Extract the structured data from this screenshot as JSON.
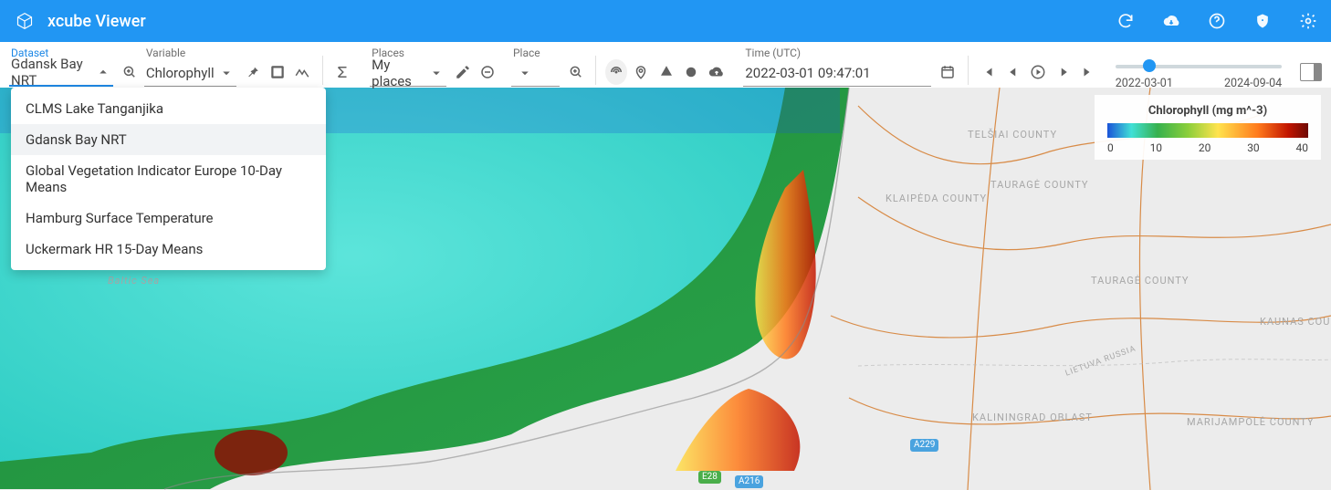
{
  "app": {
    "title": "xcube Viewer"
  },
  "header_icons": [
    "refresh",
    "cloud-download",
    "help",
    "shield",
    "settings"
  ],
  "toolbar": {
    "dataset": {
      "label": "Dataset",
      "value": "Gdansk Bay NRT"
    },
    "variable": {
      "label": "Variable",
      "value": "Chlorophyll"
    },
    "places": {
      "label": "Places",
      "value": "My places"
    },
    "place": {
      "label": "Place",
      "value": ""
    },
    "time": {
      "label": "Time (UTC)",
      "value": "2022-03-01 09:47:01"
    }
  },
  "dataset_options": [
    "CLMS Lake Tanganjika",
    "Gdansk Bay NRT",
    "Global Vegetation Indicator Europe 10-Day Means",
    "Hamburg Surface Temperature",
    "Uckermark HR 15-Day Means"
  ],
  "dataset_selected_index": 1,
  "timeline": {
    "start": "2022-03-01",
    "end": "2024-09-04"
  },
  "legend": {
    "title": "Chlorophyll (mg m^-3)",
    "ticks": [
      "0",
      "10",
      "20",
      "30",
      "40"
    ]
  },
  "map_labels": {
    "sea": "Baltic Sea",
    "telsiai": "TELŠIAI COUNTY",
    "klaipeda": "KLAIPĖDA COUNTY",
    "taurage1": "TAURAGĖ COUNTY",
    "taurage2": "TAURAGĖ COUNTY",
    "kaunas": "KAUNAS COU",
    "marijampole": "MARIJAMPOLĖ COUNTY",
    "kaliningrad": "KALININGRAD OBLAST",
    "lietuva_russia": "LIETUVA   RUSSIA",
    "a229": "A229",
    "e28": "E28",
    "a216": "A216"
  }
}
